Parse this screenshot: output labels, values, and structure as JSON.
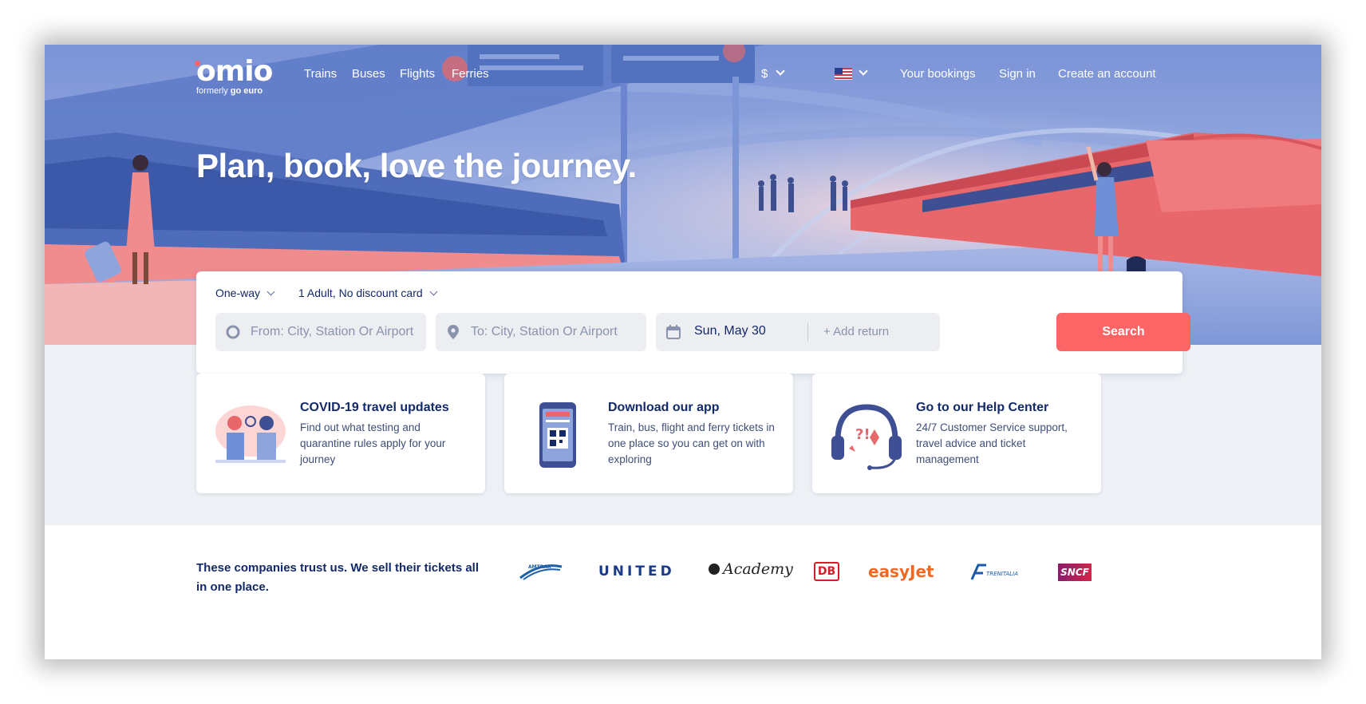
{
  "brand": {
    "name": "omio",
    "formerly_prefix": "formerly",
    "formerly_name": "go euro",
    "accent": "#fc6565",
    "navy": "#132968"
  },
  "nav": {
    "links": [
      "Trains",
      "Buses",
      "Flights",
      "Ferries"
    ],
    "currency": "$",
    "locale_flag": "us-flag-icon",
    "your_bookings": "Your bookings",
    "sign_in": "Sign in",
    "create_account": "Create an account"
  },
  "hero": {
    "headline": "Plan, book, love the journey."
  },
  "search": {
    "trip_type": "One-way",
    "passengers": "1 Adult, No discount card",
    "from_placeholder": "From: City, Station Or Airport",
    "to_placeholder": "To: City, Station Or Airport",
    "date": "Sun, May 30",
    "add_return": "+ Add return",
    "button": "Search"
  },
  "cards": [
    {
      "title": "COVID-19 travel updates",
      "description": "Find out what testing and quarantine rules apply for your journey",
      "icon": "covid-travelers-illustration"
    },
    {
      "title": "Download our app",
      "description": "Train, bus, flight and ferry tickets in one place so you can get on with exploring",
      "icon": "phone-ticket-illustration"
    },
    {
      "title": "Go to our Help Center",
      "description": "24/7 Customer Service support, travel advice and ticket management",
      "icon": "headset-illustration"
    }
  ],
  "partners": {
    "heading": "These companies trust us. We sell their tickets all in one place.",
    "logos": [
      {
        "name": "AMTRAK",
        "icon": "amtrak-logo"
      },
      {
        "name": "UNITED",
        "icon": "united-logo"
      },
      {
        "name": "Academy",
        "icon": "academy-logo"
      },
      {
        "name": "DB",
        "icon": "db-logo"
      },
      {
        "name": "easyJet",
        "icon": "easyjet-logo"
      },
      {
        "name": "TRENITALIA",
        "icon": "trenitalia-logo"
      },
      {
        "name": "SNCF",
        "icon": "sncf-logo"
      }
    ]
  }
}
